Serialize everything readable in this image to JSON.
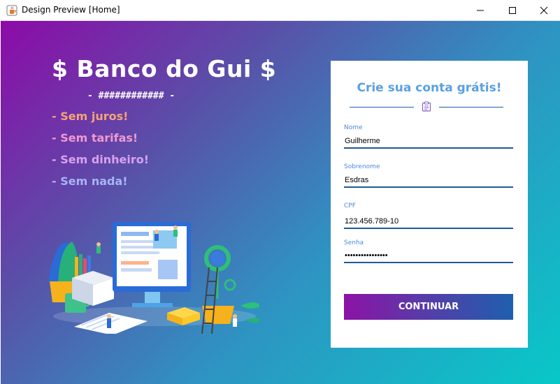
{
  "window": {
    "title": "Design Preview [Home]",
    "app_icon": "java-cup-icon",
    "controls": [
      "minimize-icon",
      "maximize-icon",
      "close-icon"
    ]
  },
  "brand": {
    "title": "$ Banco do Gui $",
    "subtitle": "- ############ -",
    "features": [
      {
        "label": "- Sem juros!",
        "color": "#f7a278"
      },
      {
        "label": "- Sem tarifas!",
        "color": "#f09ad0"
      },
      {
        "label": "- Sem dinheiro!",
        "color": "#d9a2ef"
      },
      {
        "label": "- Sem nada!",
        "color": "#a7b4f5"
      }
    ]
  },
  "signup": {
    "title": "Crie sua conta grátis!",
    "divider_icon": "form-clipboard-icon",
    "fields": [
      {
        "label": "Nome",
        "value": "Guilherme"
      },
      {
        "label": "Sobrenome",
        "value": "Esdras"
      },
      {
        "label": "CPF",
        "value": "123.456.789-10"
      },
      {
        "label": "Senha",
        "value": "••••••••••••••••"
      }
    ],
    "submit_label": "CONTINUAR"
  },
  "colors": {
    "gradient_start": "#8d0aa8",
    "gradient_end": "#08c8c8",
    "card_title": "#5aa0e0",
    "field_label": "#4a8ad6",
    "field_underline": "#1f5a8f"
  }
}
